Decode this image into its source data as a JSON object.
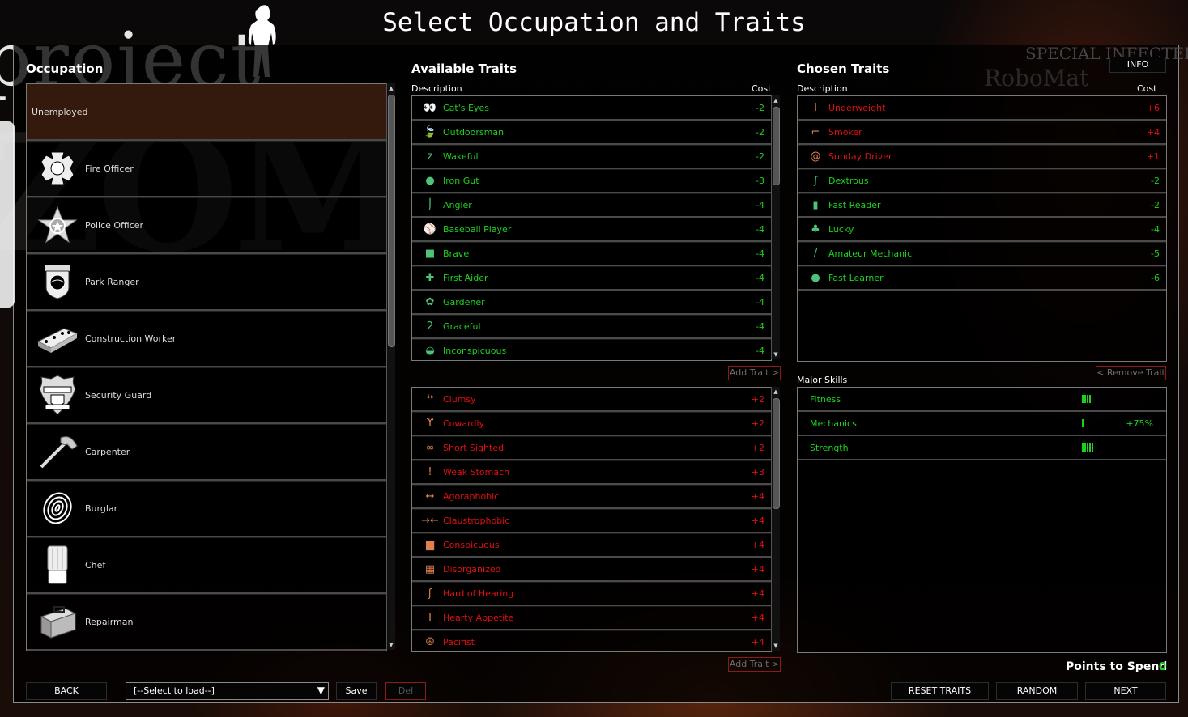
{
  "title": "Select Occupation and Traits",
  "watermark": {
    "project": "project",
    "zomboid": "ZOMBOID",
    "special": "SPECIAL INFECTED",
    "robomat": "RoboMat"
  },
  "occupation": {
    "heading": "Occupation",
    "items": [
      {
        "label": "Unemployed",
        "icon": "none",
        "selected": true
      },
      {
        "label": "Fire Officer",
        "icon": "fire-department-badge-icon"
      },
      {
        "label": "Police Officer",
        "icon": "sheriff-star-icon"
      },
      {
        "label": "Park Ranger",
        "icon": "park-ranger-badge-icon"
      },
      {
        "label": "Construction Worker",
        "icon": "bricks-icon"
      },
      {
        "label": "Security Guard",
        "icon": "security-badge-icon"
      },
      {
        "label": "Carpenter",
        "icon": "hammer-icon"
      },
      {
        "label": "Burglar",
        "icon": "fingerprint-icon"
      },
      {
        "label": "Chef",
        "icon": "chef-hat-icon"
      },
      {
        "label": "Repairman",
        "icon": "toolbox-icon"
      }
    ]
  },
  "available": {
    "heading": "Available Traits",
    "col_description": "Description",
    "col_cost": "Cost",
    "positive": [
      {
        "label": "Cat's Eyes",
        "cost": "-2",
        "icon": "cat-eyes-icon",
        "glyph": "👀"
      },
      {
        "label": "Outdoorsman",
        "cost": "-2",
        "icon": "leaf-icon",
        "glyph": "🍃"
      },
      {
        "label": "Wakeful",
        "cost": "-2",
        "icon": "zzz-icon",
        "glyph": "z"
      },
      {
        "label": "Iron Gut",
        "cost": "-3",
        "icon": "stomach-icon",
        "glyph": "●"
      },
      {
        "label": "Angler",
        "cost": "-4",
        "icon": "fishing-hook-icon",
        "glyph": "⌡"
      },
      {
        "label": "Baseball Player",
        "cost": "-4",
        "icon": "baseball-icon",
        "glyph": "⚾"
      },
      {
        "label": "Brave",
        "cost": "-4",
        "icon": "lion-icon",
        "glyph": "■"
      },
      {
        "label": "First Aider",
        "cost": "-4",
        "icon": "first-aid-cross-icon",
        "glyph": "✚"
      },
      {
        "label": "Gardener",
        "cost": "-4",
        "icon": "flower-icon",
        "glyph": "✿"
      },
      {
        "label": "Graceful",
        "cost": "-4",
        "icon": "swan-icon",
        "glyph": "2"
      },
      {
        "label": "Inconspicuous",
        "cost": "-4",
        "icon": "cap-icon",
        "glyph": "◒"
      }
    ],
    "negative": [
      {
        "label": "Clumsy",
        "cost": "+2",
        "icon": "feet-icon",
        "glyph": "❛❛"
      },
      {
        "label": "Cowardly",
        "cost": "+2",
        "icon": "wilted-flower-icon",
        "glyph": "ϒ"
      },
      {
        "label": "Short Sighted",
        "cost": "+2",
        "icon": "glasses-icon",
        "glyph": "∞"
      },
      {
        "label": "Weak Stomach",
        "cost": "+3",
        "icon": "sick-stomach-icon",
        "glyph": "!"
      },
      {
        "label": "Agoraphobic",
        "cost": "+4",
        "icon": "agoraphobia-icon",
        "glyph": "↔"
      },
      {
        "label": "Claustrophobic",
        "cost": "+4",
        "icon": "claustrophobia-icon",
        "glyph": "→←"
      },
      {
        "label": "Conspicuous",
        "cost": "+4",
        "icon": "top-hat-icon",
        "glyph": "▆"
      },
      {
        "label": "Disorganized",
        "cost": "+4",
        "icon": "disorganized-icon",
        "glyph": "▦"
      },
      {
        "label": "Hard of Hearing",
        "cost": "+4",
        "icon": "ear-icon",
        "glyph": "ʃ"
      },
      {
        "label": "Hearty Appetite",
        "cost": "+4",
        "icon": "apple-core-icon",
        "glyph": "I"
      },
      {
        "label": "Pacifist",
        "cost": "+4",
        "icon": "peace-icon",
        "glyph": "☮"
      }
    ],
    "add_trait_label": "Add Trait >"
  },
  "chosen": {
    "heading": "Chosen Traits",
    "col_description": "Description",
    "col_cost": "Cost",
    "info_label": "INFO",
    "items": [
      {
        "label": "Underweight",
        "cost": "+6",
        "type": "neg",
        "icon": "thin-figure-icon",
        "glyph": "I"
      },
      {
        "label": "Smoker",
        "cost": "+4",
        "type": "neg",
        "icon": "cigarette-icon",
        "glyph": "⌐"
      },
      {
        "label": "Sunday Driver",
        "cost": "+1",
        "type": "neg",
        "icon": "snail-icon",
        "glyph": "@"
      },
      {
        "label": "Dextrous",
        "cost": "-2",
        "type": "pos",
        "icon": "needle-thread-icon",
        "glyph": "∫"
      },
      {
        "label": "Fast Reader",
        "cost": "-2",
        "type": "pos",
        "icon": "book-icon",
        "glyph": "▮"
      },
      {
        "label": "Lucky",
        "cost": "-4",
        "type": "pos",
        "icon": "four-leaf-clover-icon",
        "glyph": "♣"
      },
      {
        "label": "Amateur Mechanic",
        "cost": "-5",
        "type": "pos",
        "icon": "wrench-icon",
        "glyph": "/"
      },
      {
        "label": "Fast Learner",
        "cost": "-6",
        "type": "pos",
        "icon": "brain-icon",
        "glyph": "●"
      }
    ],
    "remove_trait_label": "< Remove Trait"
  },
  "skills": {
    "heading": "Major Skills",
    "items": [
      {
        "label": "Fitness",
        "level": 4,
        "boost": ""
      },
      {
        "label": "Mechanics",
        "level": 1,
        "boost": "+75%"
      },
      {
        "label": "Strength",
        "level": 5,
        "boost": ""
      }
    ]
  },
  "points": {
    "label": "Points to Spend",
    "value": "0"
  },
  "footer": {
    "back": "BACK",
    "preset_select": "[--Select to load--]",
    "save": "Save",
    "del": "Del",
    "reset": "RESET TRAITS",
    "random": "RANDOM",
    "next": "NEXT"
  },
  "colors": {
    "positive": "#1fd11f",
    "negative": "#e01010",
    "selected_bg": "#341a0c"
  }
}
